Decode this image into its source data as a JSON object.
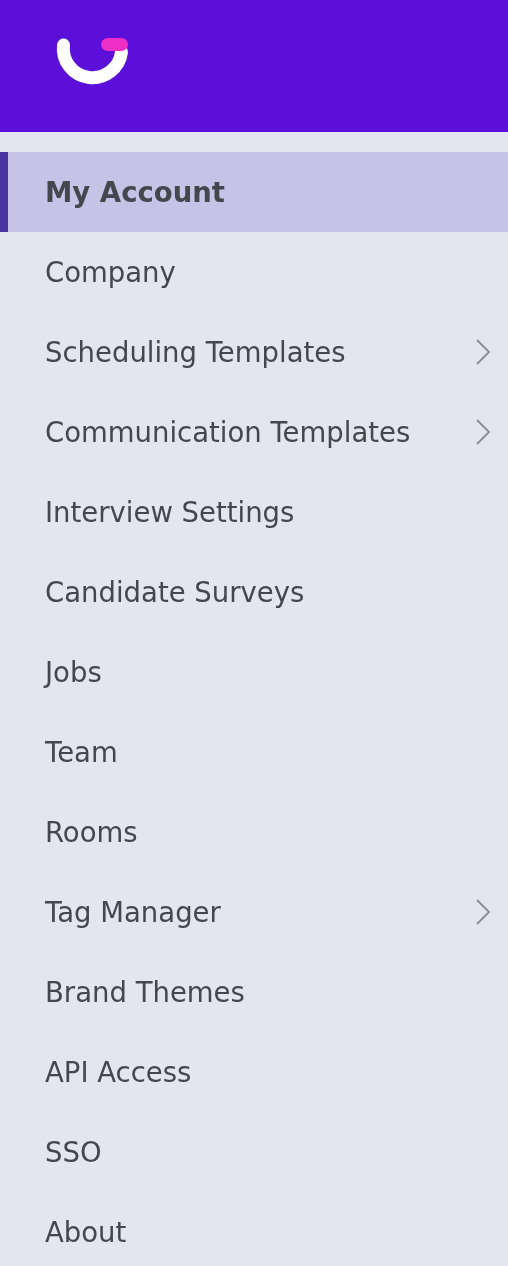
{
  "menu": [
    {
      "label": "My Account",
      "selected": true,
      "has_submenu": false
    },
    {
      "label": "Company",
      "selected": false,
      "has_submenu": false
    },
    {
      "label": "Scheduling Templates",
      "selected": false,
      "has_submenu": true
    },
    {
      "label": "Communication Templates",
      "selected": false,
      "has_submenu": true
    },
    {
      "label": "Interview Settings",
      "selected": false,
      "has_submenu": false
    },
    {
      "label": "Candidate Surveys",
      "selected": false,
      "has_submenu": false
    },
    {
      "label": "Jobs",
      "selected": false,
      "has_submenu": false
    },
    {
      "label": "Team",
      "selected": false,
      "has_submenu": false
    },
    {
      "label": "Rooms",
      "selected": false,
      "has_submenu": false
    },
    {
      "label": "Tag Manager",
      "selected": false,
      "has_submenu": true
    },
    {
      "label": "Brand Themes",
      "selected": false,
      "has_submenu": false
    },
    {
      "label": "API Access",
      "selected": false,
      "has_submenu": false
    },
    {
      "label": "SSO",
      "selected": false,
      "has_submenu": false
    },
    {
      "label": "About",
      "selected": false,
      "has_submenu": false
    }
  ]
}
